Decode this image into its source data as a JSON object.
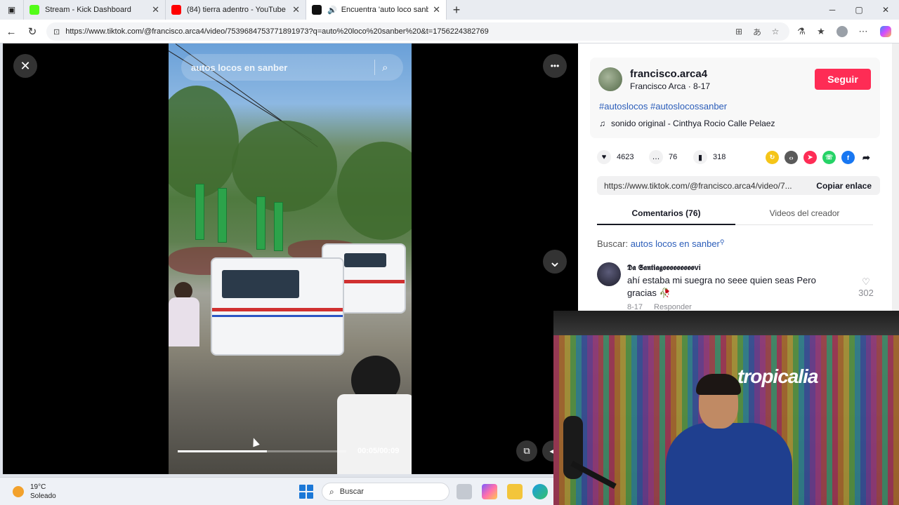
{
  "browser": {
    "tabs": [
      {
        "label": "Stream - Kick Dashboard",
        "favicon_color": "#53fc18",
        "active": false
      },
      {
        "label": "(84) tierra adentro - YouTube",
        "favicon_color": "#ff0000",
        "active": false
      },
      {
        "label": "Encuentra 'auto loco sanber",
        "favicon_color": "#111111",
        "active": true
      }
    ],
    "new_tab": "+",
    "url": "https://www.tiktok.com/@francisco.arca4/video/7539684753771891973?q=auto%20loco%20sanber%20&t=1756224382769"
  },
  "video": {
    "search_placeholder": "autos locos en sanber",
    "close_glyph": "✕",
    "more_glyph": "•••",
    "down_glyph": "⌄",
    "time": "00:05/00:09",
    "progress_fraction": 0.53
  },
  "post": {
    "username": "francisco.arca4",
    "subline": "Francisco Arca · 8-17",
    "follow_label": "Seguir",
    "hashtags": "#autoslocos #autoslocossanber",
    "sound": "sonido original - Cinthya Rocio Calle Pelaez",
    "likes": "4623",
    "comments": "76",
    "saves": "318",
    "copy_url": "https://www.tiktok.com/@francisco.arca4/video/7...",
    "copy_label": "Copiar enlace",
    "tab_comments": "Comentarios (76)",
    "tab_creator": "Videos del creador",
    "search_prefix": "Buscar: ",
    "search_keyword": "autos locos en sanber"
  },
  "comment": {
    "user": "𝕯𝖆 𝕾𝖆𝖓𝖙𝖎𝖆𝖌𝖔𝖔𝖔𝖔𝖔𝖔𝖔𝖔𝖔vi",
    "text": "ahí estaba mi suegra no seee quien seas Pero gracias 🥀",
    "date": "8-17",
    "reply": "Responder",
    "likes": "302"
  },
  "webcam": {
    "logo": "tropicalia"
  },
  "taskbar": {
    "temp": "19°C",
    "condition": "Soleado",
    "search_label": "Buscar"
  }
}
